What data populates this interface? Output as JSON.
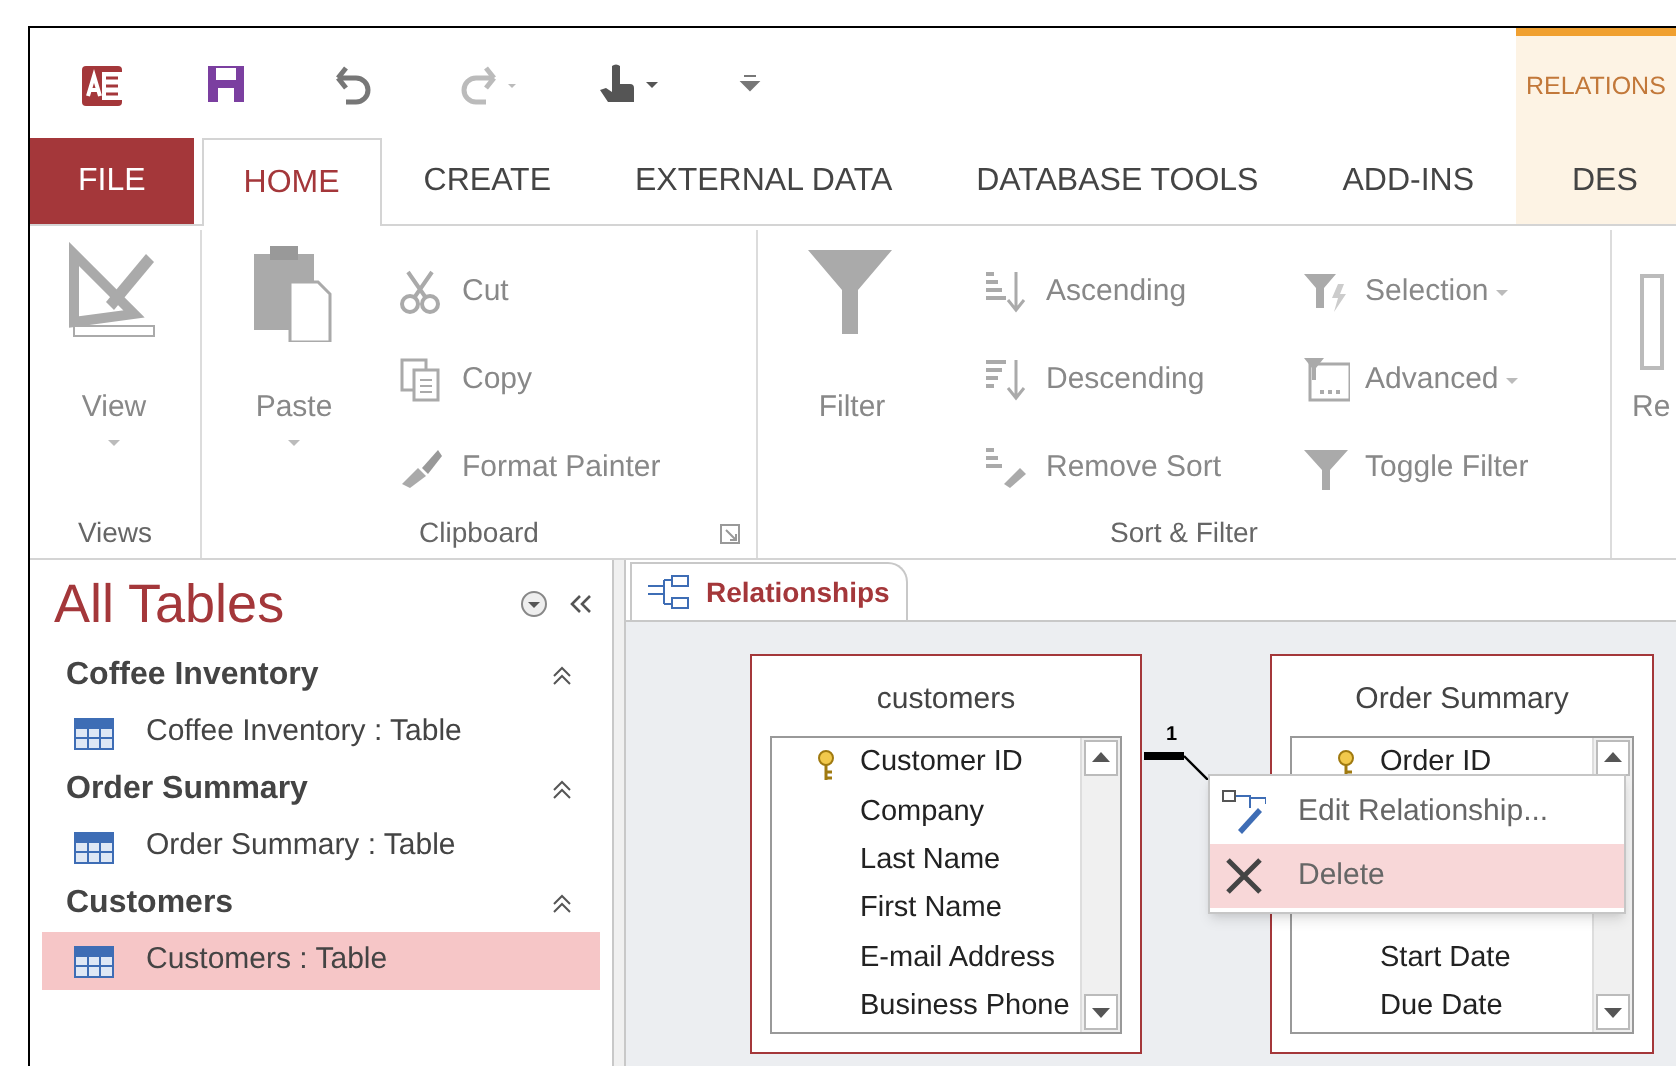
{
  "quick_access": {
    "contextual_label": "RELATIONS"
  },
  "tabs": [
    {
      "label": "FILE",
      "kind": "file",
      "selected": false
    },
    {
      "label": "HOME",
      "kind": "tab",
      "selected": true
    },
    {
      "label": "CREATE",
      "kind": "tab",
      "selected": false
    },
    {
      "label": "EXTERNAL DATA",
      "kind": "tab",
      "selected": false
    },
    {
      "label": "DATABASE TOOLS",
      "kind": "tab",
      "selected": false
    },
    {
      "label": "ADD-INS",
      "kind": "tab",
      "selected": false
    },
    {
      "label": "DES",
      "kind": "contextual",
      "selected": false
    }
  ],
  "ribbon": {
    "groups": [
      {
        "label": "Views",
        "large": [
          {
            "label": "View",
            "dropdown": true
          }
        ]
      },
      {
        "label": "Clipboard",
        "launcher": true,
        "large": [
          {
            "label": "Paste",
            "dropdown": true
          }
        ],
        "columns": [
          [
            {
              "label": "Cut"
            },
            {
              "label": "Copy"
            },
            {
              "label": "Format Painter"
            }
          ]
        ]
      },
      {
        "label": "Sort & Filter",
        "large": [
          {
            "label": "Filter"
          }
        ],
        "columns": [
          [
            {
              "label": "Ascending"
            },
            {
              "label": "Descending"
            },
            {
              "label": "Remove Sort"
            }
          ],
          [
            {
              "label": "Selection",
              "dropdown": true
            },
            {
              "label": "Advanced",
              "dropdown": true
            },
            {
              "label": "Toggle Filter"
            }
          ]
        ]
      }
    ],
    "partial_label": "Re"
  },
  "nav_pane": {
    "title": "All Tables",
    "groups": [
      {
        "name": "Coffee Inventory",
        "items": [
          {
            "label": "Coffee Inventory : Table",
            "selected": false
          }
        ]
      },
      {
        "name": "Order Summary",
        "items": [
          {
            "label": "Order Summary : Table",
            "selected": false
          }
        ]
      },
      {
        "name": "Customers",
        "items": [
          {
            "label": "Customers : Table",
            "selected": true
          }
        ]
      }
    ]
  },
  "document_tab": {
    "label": "Relationships"
  },
  "tables": [
    {
      "title": "customers",
      "rows": [
        {
          "kind": "field",
          "name": "Customer ID",
          "key": true
        },
        {
          "kind": "field",
          "name": "Company",
          "key": false
        },
        {
          "kind": "field",
          "name": "Last Name",
          "key": false
        },
        {
          "kind": "field",
          "name": "First Name",
          "key": false
        },
        {
          "kind": "field",
          "name": "E-mail Address",
          "key": false
        },
        {
          "kind": "field",
          "name": "Business Phone",
          "key": false
        }
      ]
    },
    {
      "title": "Order Summary",
      "rows": [
        {
          "kind": "field",
          "name": "Order ID",
          "key": true
        },
        {
          "kind": "covered"
        },
        {
          "kind": "covered"
        },
        {
          "kind": "covered"
        },
        {
          "kind": "field",
          "name": "Start Date",
          "key": false
        },
        {
          "kind": "field",
          "name": "Due Date",
          "key": false
        }
      ]
    }
  ],
  "relationship": {
    "one_label": "1"
  },
  "context_menu": [
    {
      "label": "Edit Relationship...",
      "selected": false
    },
    {
      "label": "Delete",
      "selected": true
    }
  ]
}
